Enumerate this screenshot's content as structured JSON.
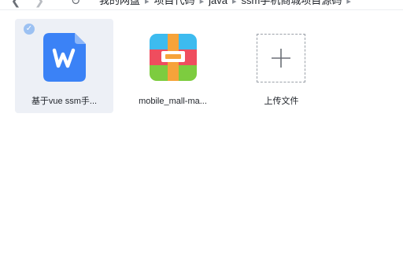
{
  "nav": {
    "back_glyph": "❮",
    "forward_glyph": "❯",
    "refresh_glyph": "↻"
  },
  "breadcrumb": {
    "items": [
      "我的网盘",
      "项目代码",
      "java",
      "ssm手机商城项目源码"
    ],
    "separator": "▸"
  },
  "files": [
    {
      "name": "基于vue ssm手...",
      "icon": "wps-word-icon",
      "selected": true
    },
    {
      "name": "mobile_mall-ma...",
      "icon": "rar-archive-icon",
      "selected": false
    }
  ],
  "upload": {
    "label": "上传文件",
    "icon": "plus-icon"
  },
  "colors": {
    "accent": "#3b82f6",
    "selected_bg": "#edf0f6",
    "check": "#9cc1f2"
  }
}
